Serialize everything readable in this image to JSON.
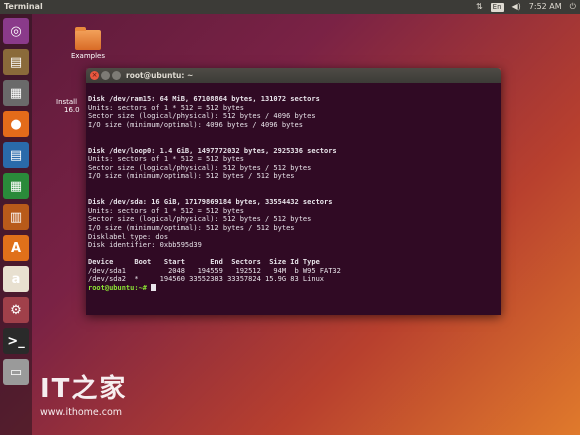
{
  "panel": {
    "app_title": "Terminal",
    "lang": "En",
    "time": "7:52 AM"
  },
  "launcher": {
    "items": [
      {
        "name": "dash-icon",
        "glyph": "◎",
        "color": "#8a3a8a"
      },
      {
        "name": "files-icon",
        "glyph": "▤",
        "color": "#8a6a3a"
      },
      {
        "name": "file-manager-icon",
        "glyph": "▦",
        "color": "#6a6a6a"
      },
      {
        "name": "firefox-icon",
        "glyph": "●",
        "color": "#e46b1a"
      },
      {
        "name": "writer-icon",
        "glyph": "▤",
        "color": "#2a6aaa"
      },
      {
        "name": "calc-icon",
        "glyph": "▦",
        "color": "#2a8a3a"
      },
      {
        "name": "impress-icon",
        "glyph": "▥",
        "color": "#b85a1a"
      },
      {
        "name": "software-center-icon",
        "glyph": "A",
        "color": "#e0701a"
      },
      {
        "name": "amazon-icon",
        "glyph": "a",
        "color": "#e8e0d0"
      },
      {
        "name": "settings-icon",
        "glyph": "⚙",
        "color": "#a0404a"
      },
      {
        "name": "terminal-icon",
        "glyph": ">_",
        "color": "#2a2a2a"
      },
      {
        "name": "trash-icon",
        "glyph": "▭",
        "color": "#9a9a9a"
      }
    ]
  },
  "desktop": {
    "examples_label": "Examples",
    "install_label": "Install",
    "install_sub": "16.0"
  },
  "terminal": {
    "title": "root@ubuntu: ~",
    "lines": [
      {
        "text": "Disk /dev/ram15: 64 MiB, 67108864 bytes, 131072 sectors",
        "bold": true
      },
      {
        "text": "Units: sectors of 1 * 512 = 512 bytes",
        "bold": false
      },
      {
        "text": "Sector size (logical/physical): 512 bytes / 4096 bytes",
        "bold": false
      },
      {
        "text": "I/O size (minimum/optimal): 4096 bytes / 4096 bytes",
        "bold": false
      },
      {
        "text": "",
        "bold": false
      },
      {
        "text": "",
        "bold": false
      },
      {
        "text": "Disk /dev/loop0: 1.4 GiB, 1497772032 bytes, 2925336 sectors",
        "bold": true
      },
      {
        "text": "Units: sectors of 1 * 512 = 512 bytes",
        "bold": false
      },
      {
        "text": "Sector size (logical/physical): 512 bytes / 512 bytes",
        "bold": false
      },
      {
        "text": "I/O size (minimum/optimal): 512 bytes / 512 bytes",
        "bold": false
      },
      {
        "text": "",
        "bold": false
      },
      {
        "text": "",
        "bold": false
      },
      {
        "text": "Disk /dev/sda: 16 GiB, 17179869184 bytes, 33554432 sectors",
        "bold": true
      },
      {
        "text": "Units: sectors of 1 * 512 = 512 bytes",
        "bold": false
      },
      {
        "text": "Sector size (logical/physical): 512 bytes / 512 bytes",
        "bold": false
      },
      {
        "text": "I/O size (minimum/optimal): 512 bytes / 512 bytes",
        "bold": false
      },
      {
        "text": "Disklabel type: dos",
        "bold": false
      },
      {
        "text": "Disk identifier: 0xbb595d39",
        "bold": false
      },
      {
        "text": "",
        "bold": false
      },
      {
        "text": "Device     Boot   Start      End  Sectors  Size Id Type",
        "bold": true
      },
      {
        "text": "/dev/sda1          2048   194559   192512   94M  b W95 FAT32",
        "bold": false
      },
      {
        "text": "/dev/sda2  *     194560 33552383 33357824 15.9G 83 Linux",
        "bold": false
      }
    ],
    "prompt": "root@ubuntu:~#"
  },
  "watermark": {
    "logo": "IT之家",
    "url": "www.ithome.com"
  }
}
